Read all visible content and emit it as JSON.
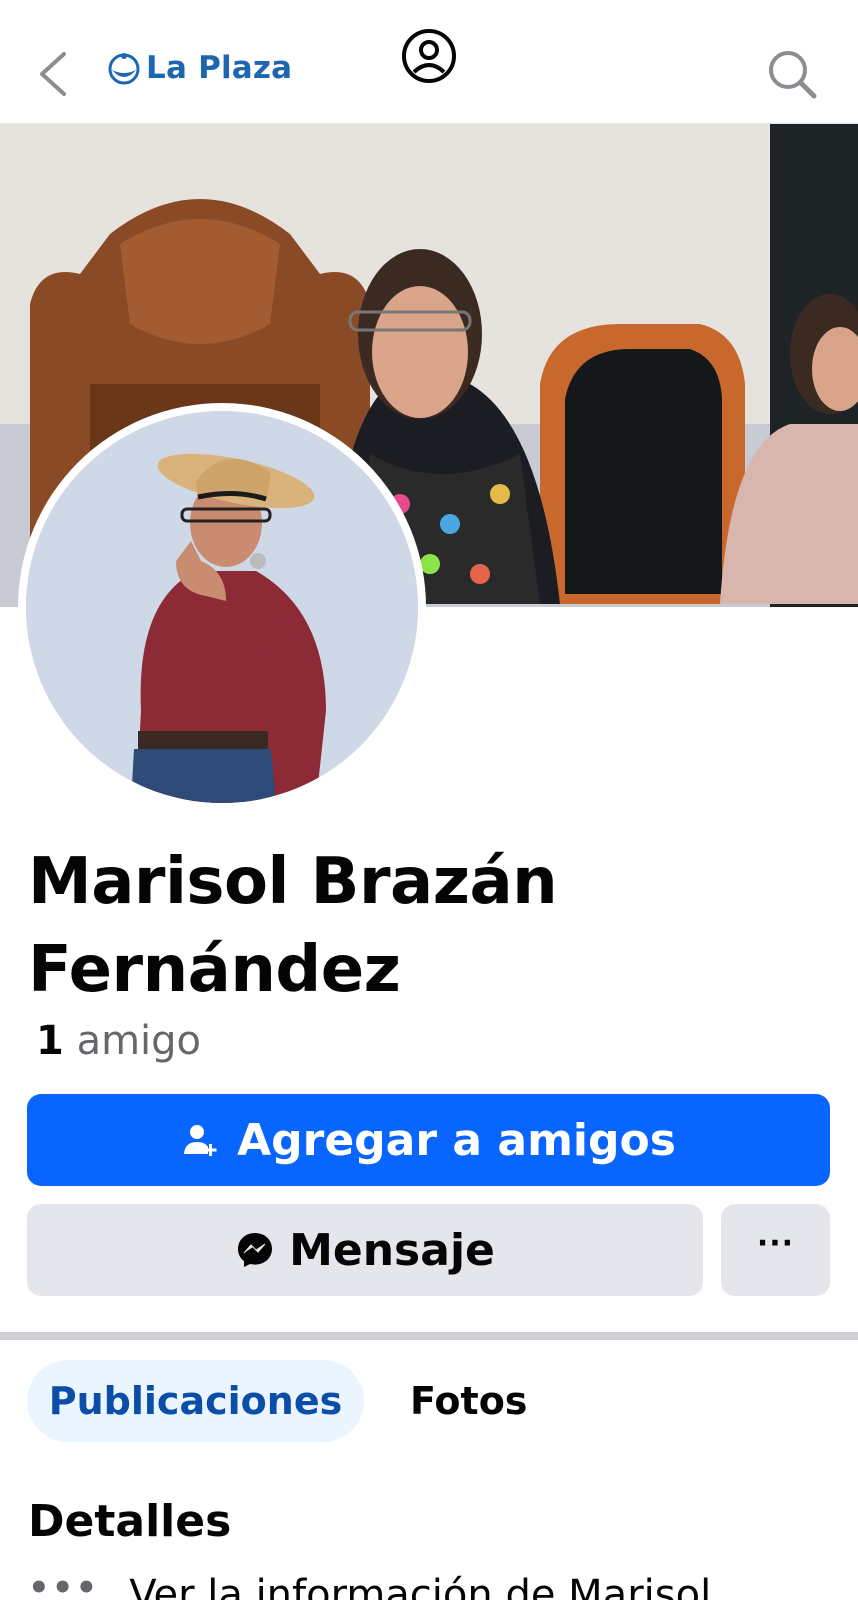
{
  "header": {
    "brand_name": "La Plaza",
    "brand_color": "#1e66b0"
  },
  "profile": {
    "name": "Marisol Brazán Fernández",
    "friend_count": "1",
    "friend_label": "amigo"
  },
  "actions": {
    "add_friend_label": "Agregar a amigos",
    "message_label": "Mensaje",
    "more_label": "···",
    "primary_color": "#0866ff"
  },
  "tabs": [
    {
      "label": "Publicaciones",
      "active": true
    },
    {
      "label": "Fotos",
      "active": false
    }
  ],
  "details": {
    "title": "Detalles",
    "info_row": "Ver la información de Marisol"
  },
  "icons": {
    "back": "chevron-left-icon",
    "profile": "user-circle-icon",
    "search": "search-icon",
    "add_friend": "user-plus-icon",
    "messenger": "messenger-icon",
    "more": "ellipsis-icon"
  }
}
